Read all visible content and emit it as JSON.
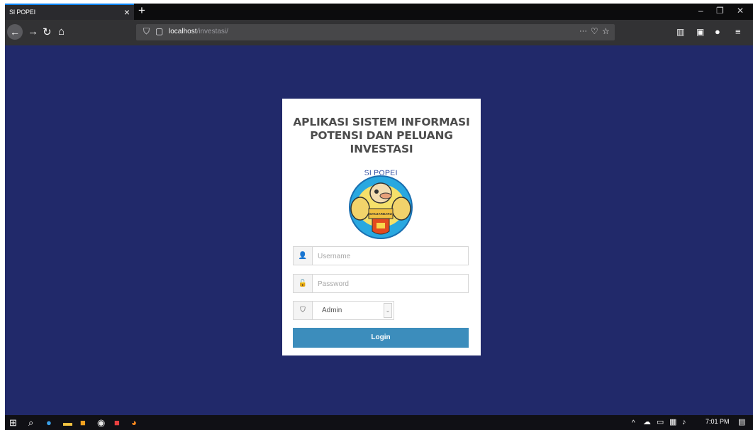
{
  "browser": {
    "tab_title": "SI POPEI",
    "tab_close": "×",
    "new_tab": "+",
    "url_host": "localhost",
    "url_path": "/investasi/",
    "url_more": "···",
    "window_min": "–",
    "window_restore": "❐",
    "window_close": "✕"
  },
  "login": {
    "title_line1": "APLIKASI SISTEM INFORMASI",
    "title_line2": "POTENSI DAN PELUANG",
    "title_line3": "INVESTASI",
    "logo_text": "SI POPEI",
    "logo_badge": "BANJARBARU",
    "username_placeholder": "Username",
    "password_placeholder": "Password",
    "role_value": "Admin",
    "login_label": "Login"
  },
  "taskbar": {
    "time": "7:01 PM"
  },
  "colors": {
    "page_bg": "#21296a",
    "button": "#3c8dbc",
    "accent_tab": "#0a84ff"
  }
}
